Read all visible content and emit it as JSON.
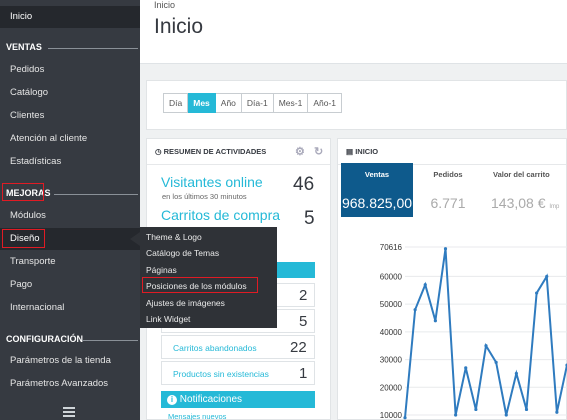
{
  "sidebar": {
    "home": "Inicio",
    "section_ventas": "VENTAS",
    "ventas_items": [
      "Pedidos",
      "Catálogo",
      "Clientes",
      "Atención al cliente",
      "Estadísticas"
    ],
    "section_mejoras": "MEJORAS",
    "mejoras_items": [
      "Módulos",
      "Diseño",
      "Transporte",
      "Pago",
      "Internacional"
    ],
    "section_config": "CONFIGURACIÓN",
    "config_items": [
      "Parámetros de la tienda",
      "Parámetros Avanzados"
    ]
  },
  "submenu": {
    "items": [
      "Theme & Logo",
      "Catálogo de Temas",
      "Páginas",
      "Posiciones de los módulos",
      "Ajustes de imágenes",
      "Link Widget"
    ]
  },
  "header": {
    "breadcrumb": "Inicio",
    "title": "Inicio"
  },
  "date_range": {
    "buttons": [
      "Día",
      "Mes",
      "Año",
      "Día-1",
      "Mes-1",
      "Año-1"
    ],
    "active": "Mes"
  },
  "activity": {
    "title": "RESUMEN DE ACTIVIDADES",
    "visitors_label": "Visitantes online",
    "visitors_sub": "en los últimos 30 minutos",
    "visitors_value": "46",
    "carts_label": "Carritos de compra",
    "carts_value": "5",
    "stat_values": [
      "2",
      "5"
    ],
    "abandoned_label": "Carritos abandonados",
    "abandoned_value": "22",
    "out_of_stock_label": "Productos sin existencias",
    "out_of_stock_value": "1",
    "notifications": "Notificaciones",
    "notifications_sub": "Mensajes nuevos"
  },
  "dashboard": {
    "title": "INICIO",
    "kpis": [
      {
        "label": "Ventas",
        "value": "968.825,00"
      },
      {
        "label": "Pedidos",
        "value": "6.771"
      },
      {
        "label": "Valor del carrito",
        "value": "143,08 €",
        "suffix": "Imp"
      }
    ]
  },
  "chart_data": {
    "type": "line",
    "ylim": [
      10000,
      70616
    ],
    "yticks": [
      "70616",
      "60000",
      "50000",
      "40000",
      "30000",
      "20000",
      "10000"
    ],
    "series": [
      {
        "values": [
          9000,
          48000,
          57000,
          44000,
          70000,
          10000,
          27000,
          12000,
          35000,
          29000,
          10000,
          25000,
          12000,
          54000,
          60000,
          11000,
          28000
        ]
      }
    ],
    "color": "#2f7bbf"
  }
}
